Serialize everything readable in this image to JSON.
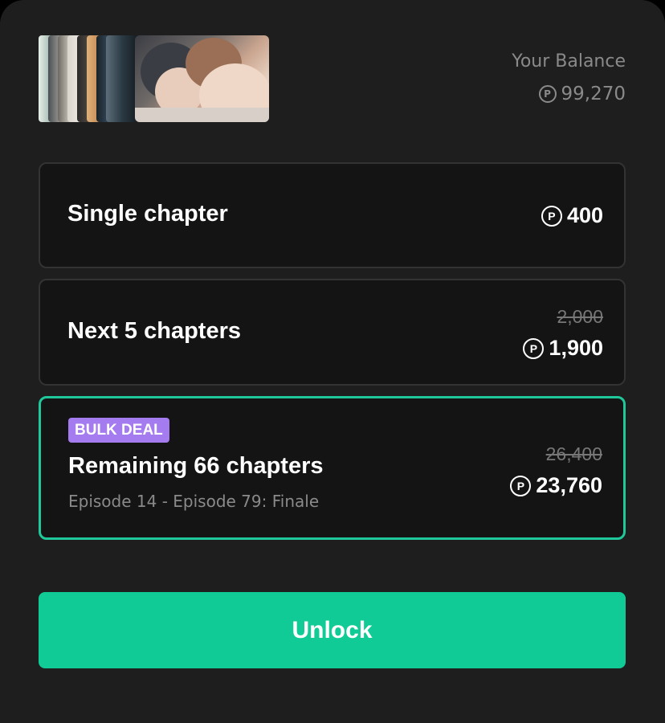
{
  "balance": {
    "label": "Your Balance",
    "amount": "99,270",
    "coin_icon": "coin-p-icon"
  },
  "options": [
    {
      "title": "Single chapter",
      "price": "400"
    },
    {
      "title": "Next 5 chapters",
      "original_price": "2,000",
      "price": "1,900"
    },
    {
      "badge": "BULK DEAL",
      "title": "Remaining 66 chapters",
      "subtitle": "Episode 14 - Episode 79: Finale",
      "original_price": "26,400",
      "price": "23,760",
      "selected": true
    }
  ],
  "unlock_label": "Unlock",
  "colors": {
    "accent": "#10cb95",
    "selected_border": "#1fc89a",
    "badge": "#a57bf0",
    "background": "#1e1e1e"
  }
}
